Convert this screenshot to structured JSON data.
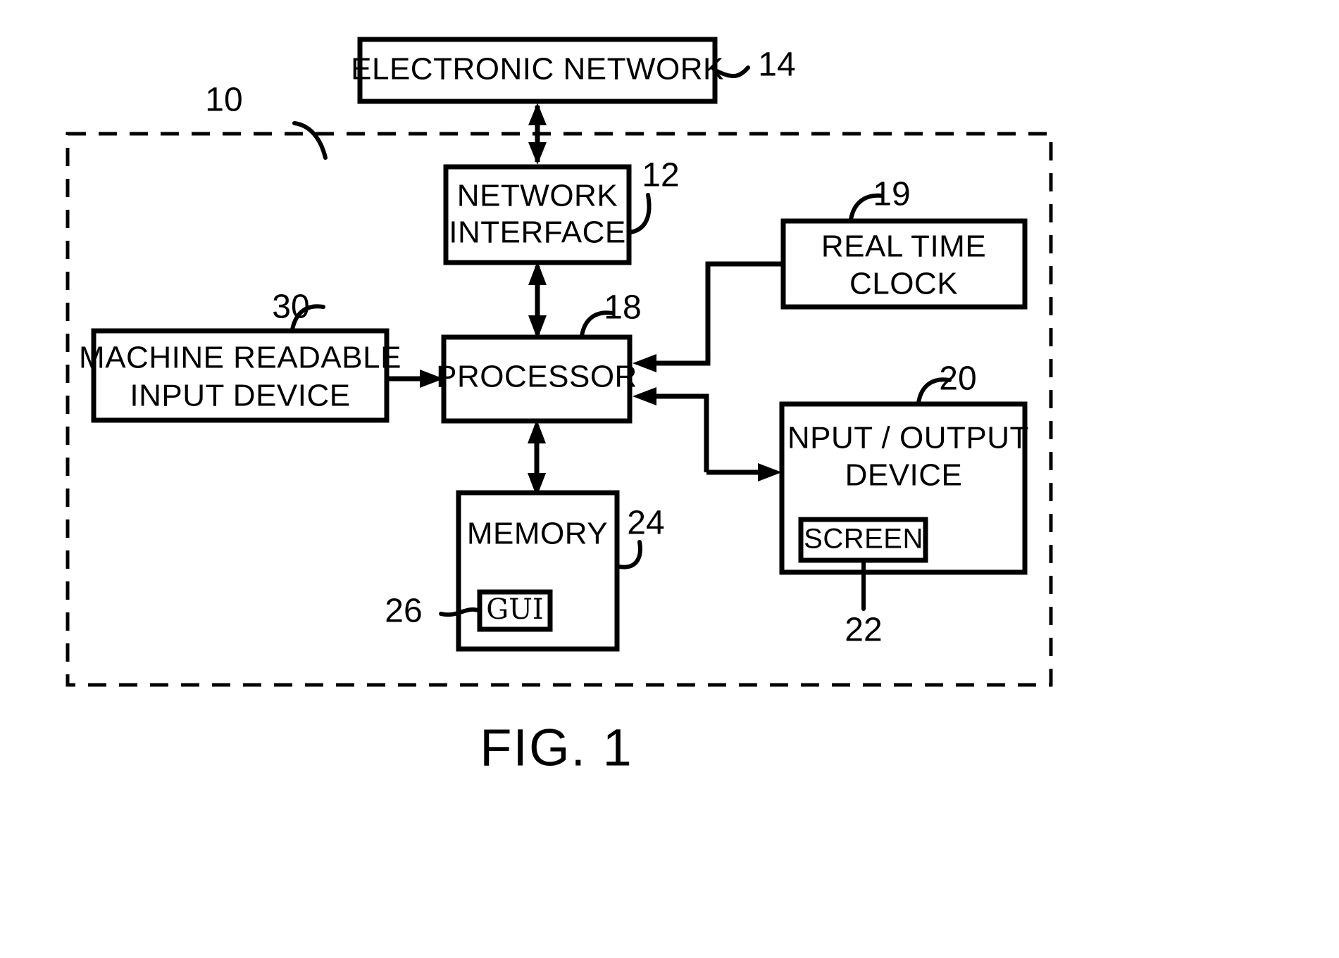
{
  "figure": {
    "caption": "FIG. 1",
    "system_ref": "10"
  },
  "blocks": [
    {
      "id": "electronic-network",
      "lines": [
        "ELECTRONIC  NETWORK"
      ],
      "ref": "14"
    },
    {
      "id": "network-interface",
      "lines": [
        "NETWORK",
        "INTERFACE"
      ],
      "ref": "12"
    },
    {
      "id": "real-time-clock",
      "lines": [
        "REAL TIME",
        "CLOCK"
      ],
      "ref": "19"
    },
    {
      "id": "machine-readable-input-device",
      "lines": [
        "MACHINE  READABLE",
        "INPUT  DEVICE"
      ],
      "ref": "30"
    },
    {
      "id": "processor",
      "lines": [
        "PROCESSOR"
      ],
      "ref": "18"
    },
    {
      "id": "input-output-device",
      "lines": [
        "INPUT / OUTPUT",
        "DEVICE"
      ],
      "ref": "20"
    },
    {
      "id": "screen",
      "lines": [
        "SCREEN"
      ],
      "ref": "22"
    },
    {
      "id": "memory",
      "lines": [
        "MEMORY"
      ],
      "ref": "24"
    },
    {
      "id": "gui",
      "lines": [
        "GUI"
      ],
      "ref": "26"
    }
  ],
  "labels": {
    "electronic_network": "ELECTRONIC  NETWORK",
    "network_interface_line1": "NETWORK",
    "network_interface_line2": "INTERFACE",
    "real_time_clock_line1": "REAL TIME",
    "real_time_clock_line2": "CLOCK",
    "machine_readable_line1": "MACHINE  READABLE",
    "machine_readable_line2": "INPUT  DEVICE",
    "processor": "PROCESSOR",
    "input_output_line1": "INPUT / OUTPUT",
    "input_output_line2": "DEVICE",
    "screen": "SCREEN",
    "memory": "MEMORY",
    "gui": "GUI",
    "caption": "FIG. 1"
  },
  "refs": {
    "system": "10",
    "network_interface": "12",
    "electronic_network": "14",
    "processor": "18",
    "real_time_clock": "19",
    "input_output_device": "20",
    "screen": "22",
    "memory": "24",
    "gui": "26",
    "machine_readable_input_device": "30"
  },
  "colors": {
    "stroke": "#000000",
    "background": "#ffffff"
  }
}
